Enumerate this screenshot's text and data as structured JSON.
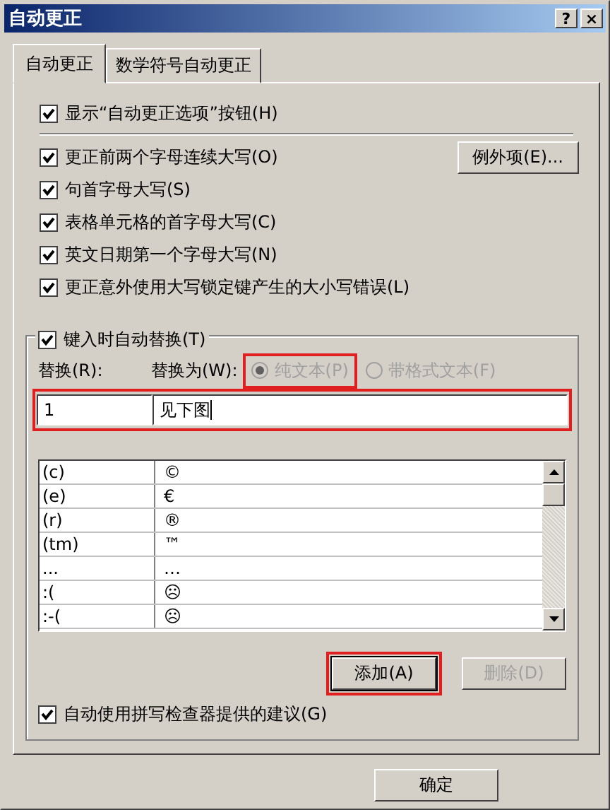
{
  "window": {
    "title": "自动更正",
    "title_buttons": [
      "?",
      "×"
    ]
  },
  "tabs": [
    {
      "label": "自动更正",
      "selected": true
    },
    {
      "label": "数学符号自动更正",
      "selected": false
    }
  ],
  "show_options": {
    "label": "显示“自动更正选项”按钮(H)",
    "checked": true
  },
  "options": [
    {
      "label": "更正前两个字母连续大写(O)",
      "checked": true
    },
    {
      "label": "句首字母大写(S)",
      "checked": true
    },
    {
      "label": "表格单元格的首字母大写(C)",
      "checked": true
    },
    {
      "label": "英文日期第一个字母大写(N)",
      "checked": true
    },
    {
      "label": "更正意外使用大写锁定键产生的大小写错误(L)",
      "checked": true
    }
  ],
  "exceptions_button": "例外项(E)...",
  "replace_group": {
    "checkbox": {
      "label": "键入时自动替换(T)",
      "checked": true
    },
    "replace_label": "替换(R):",
    "with_label": "替换为(W):",
    "radios": [
      {
        "label": "纯文本(P)",
        "selected": true,
        "disabled": true
      },
      {
        "label": "带格式文本(F)",
        "selected": false,
        "disabled": true
      }
    ],
    "replace_value": "1",
    "with_value": "见下图",
    "rows": [
      {
        "from": "(c)",
        "to": "©"
      },
      {
        "from": "(e)",
        "to": "€"
      },
      {
        "from": "(r)",
        "to": "®"
      },
      {
        "from": "(tm)",
        "to": "™"
      },
      {
        "from": "...",
        "to": "…"
      },
      {
        "from": ":(",
        "to": "☹"
      },
      {
        "from": ":-(",
        "to": "☹"
      }
    ],
    "add_button": {
      "label": "添加(A)",
      "disabled": false
    },
    "delete_button": {
      "label": "删除(D)",
      "disabled": true
    }
  },
  "spell_checkbox": {
    "label": "自动使用拼写检查器提供的建议(G)",
    "checked": true
  },
  "ok_button": "确定"
}
